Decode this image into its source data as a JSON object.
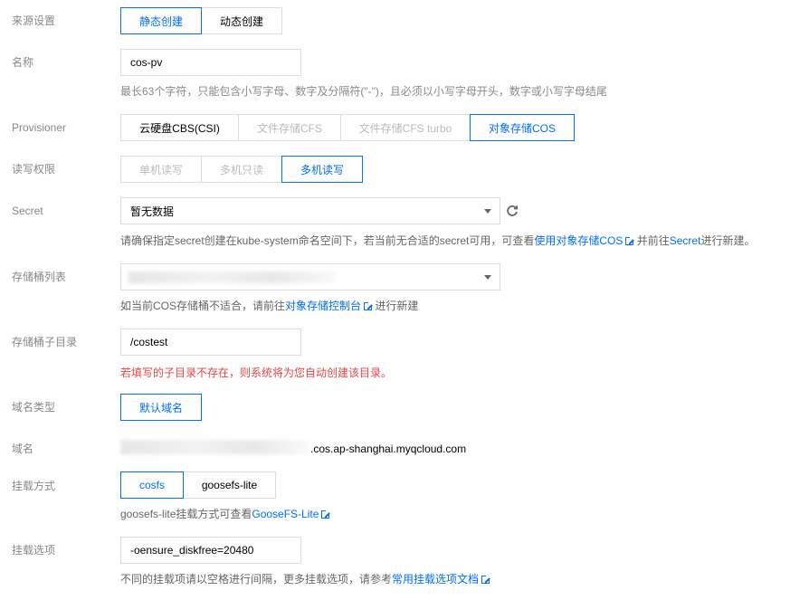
{
  "source": {
    "label": "来源设置",
    "options": [
      "静态创建",
      "动态创建"
    ]
  },
  "name": {
    "label": "名称",
    "value": "cos-pv",
    "hint": "最长63个字符，只能包含小写字母、数字及分隔符(\"-\")，且必须以小写字母开头，数字或小写字母结尾"
  },
  "provisioner": {
    "label": "Provisioner",
    "options": [
      "云硬盘CBS(CSI)",
      "文件存储CFS",
      "文件存储CFS turbo",
      "对象存储COS"
    ]
  },
  "rw": {
    "label": "读写权限",
    "options": [
      "单机读写",
      "多机只读",
      "多机读写"
    ]
  },
  "secret": {
    "label": "Secret",
    "value": "暂无数据",
    "hint_prefix": "请确保指定secret创建在kube-system命名空间下，若当前无合适的secret可用，可查看",
    "hint_link": "使用对象存储COS",
    "hint_mid": " 并前往",
    "hint_link2": "Secret",
    "hint_suffix": "进行新建。"
  },
  "bucket_list": {
    "label": "存储桶列表",
    "hint_prefix": "如当前COS存储桶不适合，请前往",
    "hint_link": "对象存储控制台",
    "hint_suffix": " 进行新建"
  },
  "bucket_subdir": {
    "label": "存储桶子目录",
    "value": "/costest",
    "warning": "若填写的子目录不存在，则系统将为您自动创建该目录。"
  },
  "domain_type": {
    "label": "域名类型",
    "button": "默认域名"
  },
  "domain": {
    "label": "域名",
    "suffix": ".cos.ap-shanghai.myqcloud.com"
  },
  "mount_method": {
    "label": "挂载方式",
    "options": [
      "cosfs",
      "goosefs-lite"
    ],
    "hint_prefix": "goosefs-lite挂载方式可查看",
    "hint_link": "GooseFS-Lite"
  },
  "mount_options": {
    "label": "挂载选项",
    "value": "-oensure_diskfree=20480",
    "hint_prefix": "不同的挂载项请以空格进行间隔，更多挂载选项，请参考",
    "hint_link": "常用挂载选项文档"
  },
  "colors": {
    "accent": "#006eff",
    "warning": "#e54545",
    "muted": "#888888"
  }
}
